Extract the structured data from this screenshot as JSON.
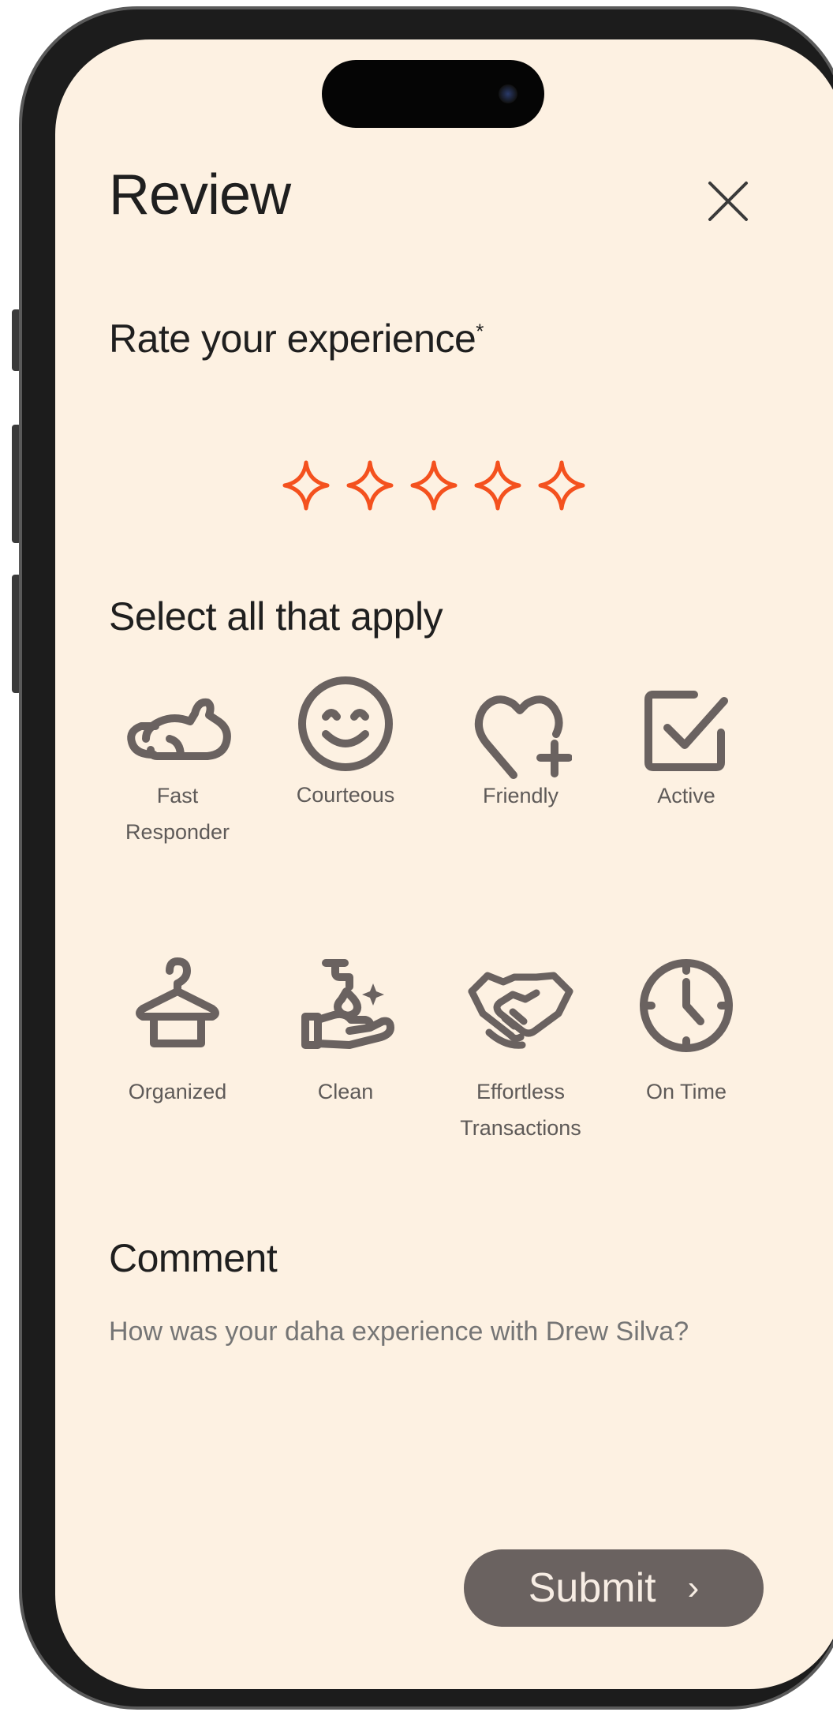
{
  "header": {
    "title": "Review",
    "close_icon": "close-icon"
  },
  "rating": {
    "label": "Rate your experience",
    "required_mark": "*",
    "max": 5,
    "value": 0,
    "star_icon": "sparkle-star-outline-icon",
    "accent_color": "#f4511e"
  },
  "traits": {
    "label": "Select all that apply",
    "items": [
      {
        "label": "Fast\nResponder",
        "icon": "rabbit-icon"
      },
      {
        "label": "Courteous",
        "icon": "smiley-icon"
      },
      {
        "label": "Friendly",
        "icon": "heart-plus-icon"
      },
      {
        "label": "Active",
        "icon": "checkbox-icon"
      },
      {
        "label": "Organized",
        "icon": "hanger-icon"
      },
      {
        "label": "Clean",
        "icon": "hand-wash-icon"
      },
      {
        "label": "Effortless\nTransactions",
        "icon": "handshake-icon"
      },
      {
        "label": "On Time",
        "icon": "clock-icon"
      }
    ]
  },
  "comment": {
    "label": "Comment",
    "placeholder": "How was your daha experience with Drew Silva?"
  },
  "submit": {
    "label": "Submit",
    "chevron": "›"
  },
  "colors": {
    "background": "#fdf1e2",
    "icon": "#6a6260",
    "button": "#6a6260",
    "accent": "#f4511e"
  }
}
